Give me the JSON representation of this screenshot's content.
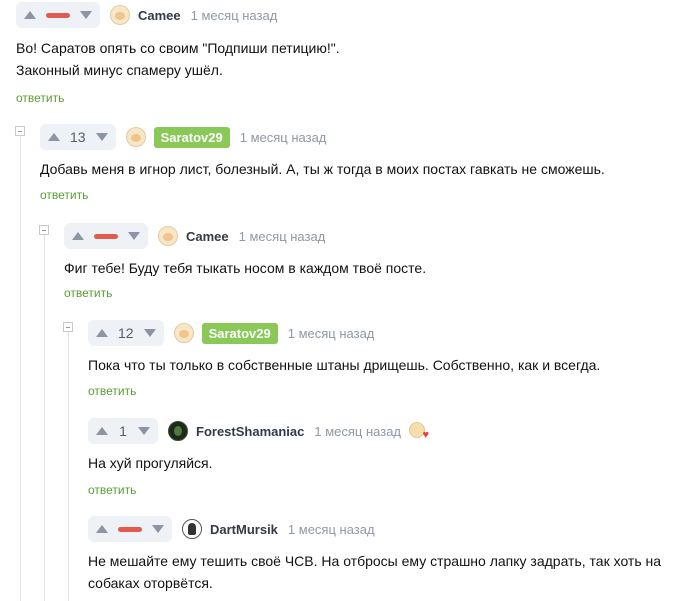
{
  "colors": {
    "accent_green": "#8ac858",
    "reply_green": "#5c9b34",
    "minus_red": "#e35a50",
    "time_gray": "#8f98a3"
  },
  "reply_label": "ответить",
  "comments": [
    {
      "author": "Camee",
      "author_badge": false,
      "avatar": "cat-avatar",
      "time": "1 месяц назад",
      "rating_type": "negative",
      "rating": "",
      "body": [
        "Во! Саратов опять со своим \"Подпиши петицию!\".",
        "Законный минус спамеру ушёл."
      ]
    },
    {
      "author": "Saratov29",
      "author_badge": true,
      "avatar": "cat-avatar",
      "time": "1 месяц назад",
      "rating_type": "count",
      "rating": "13",
      "body": [
        "Добавь меня в игнор лист, болезный. А, ты ж тогда в моих постах гавкать не сможешь."
      ]
    },
    {
      "author": "Camee",
      "author_badge": false,
      "avatar": "cat-avatar",
      "time": "1 месяц назад",
      "rating_type": "negative",
      "rating": "",
      "body": [
        "Фиг тебе! Буду тебя тыкать носом в каждом твоё посте."
      ]
    },
    {
      "author": "Saratov29",
      "author_badge": true,
      "avatar": "cat-avatar",
      "time": "1 месяц назад",
      "rating_type": "count",
      "rating": "12",
      "body": [
        "Пока что ты только в собственные штаны дрищешь. Собственно, как и всегда."
      ]
    },
    {
      "author": "ForestShamaniac",
      "author_badge": false,
      "avatar": "forest-avatar",
      "time": "1 месяц назад",
      "rating_type": "count",
      "rating": "1",
      "body": [
        "На хуй прогуляйся."
      ],
      "sticker": "heart-cat-sticker"
    },
    {
      "author": "DartMursik",
      "author_badge": false,
      "avatar": "dart-avatar",
      "time": "1 месяц назад",
      "rating_type": "negative",
      "rating": "",
      "body": [
        "Не мешайте ему тешить своё ЧСВ. На отбросы ему страшно лапку задрать, так хоть на",
        "собаках оторвётся."
      ]
    }
  ]
}
